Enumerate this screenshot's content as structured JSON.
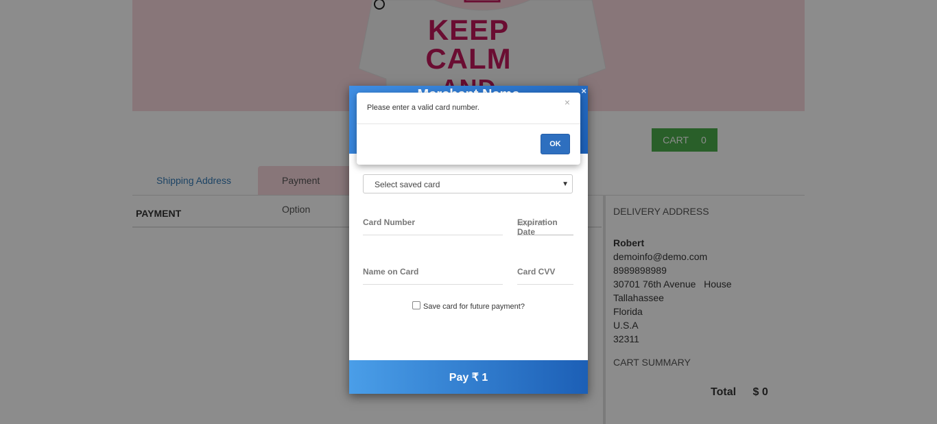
{
  "hero": {
    "shirt_lines": [
      "KEEP",
      "CALM",
      "AND"
    ]
  },
  "cart": {
    "label": "CART",
    "count": "0"
  },
  "tabs": [
    {
      "label": "Shipping Address"
    },
    {
      "label": "Payment Option"
    }
  ],
  "payment": {
    "heading": "PAYMENT"
  },
  "delivery": {
    "title": "DELIVERY ADDRESS",
    "name": "Robert",
    "email": "demoinfo@demo.com",
    "phone": "8989898989",
    "street": "30701 76th Avenue   House",
    "city": "Tallahassee",
    "state": "Florida",
    "country": "U.S.A",
    "zip": "32311"
  },
  "cart_summary": {
    "title": "CART SUMMARY",
    "total_label": "Total",
    "total_value": "$ 0"
  },
  "checkout": {
    "merchant": "Merchant Name",
    "close": "×",
    "select_placeholder": "Select saved card",
    "card_number_label": "Card Number",
    "expiry_label": "Expiration Date",
    "expiry_placeholder": "MM / YY",
    "name_label": "Name on Card",
    "cvv_label": "Card CVV",
    "save_label": "Save card for future payment?",
    "pay_label": "Pay ₹ 1"
  },
  "alert": {
    "message": "Please enter a valid card number.",
    "close": "×",
    "ok_label": "OK"
  },
  "colors": {
    "hero_bg": "#f8d7dd",
    "shirt_text": "#c2185b",
    "cart_green": "#4cae4c",
    "link_blue": "#337ab7",
    "checkout_blue": "#1c5fb6"
  }
}
